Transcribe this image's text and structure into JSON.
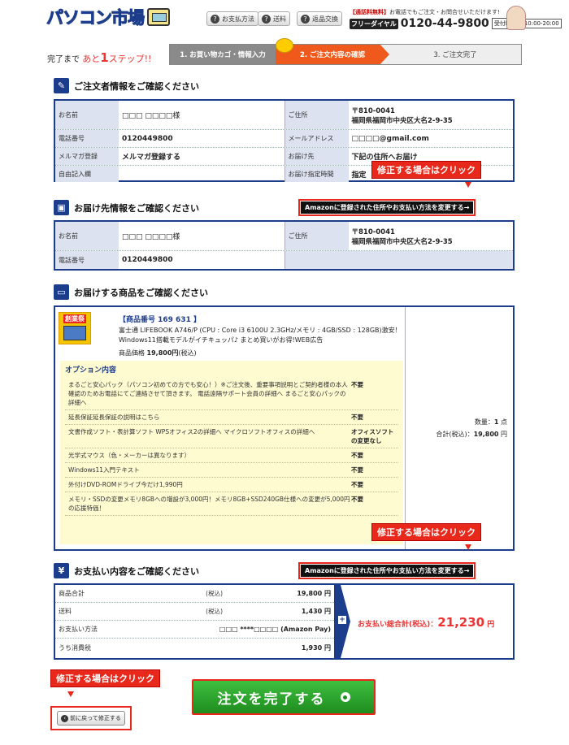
{
  "header": {
    "logo_text": "パソコン市場",
    "buttons": [
      "お支払方法",
      "送料",
      "返品交換"
    ],
    "tel_note_prefix": "【通話料無料】",
    "tel_note": "お電話でもご注文・お問合せいただけます!",
    "tel_badge": "フリーダイヤル",
    "tel_number": "0120-44-9800",
    "tel_hours_label": "受付時間",
    "tel_hours": "10:00-20:00"
  },
  "steps": {
    "left_prefix": "完了まで",
    "left_ato": "あと",
    "left_num": "1",
    "left_suffix": "ステップ!!",
    "items": [
      "1. お買い物カゴ・情報入力",
      "2. ご注文内容の確認",
      "3. ご注文完了"
    ]
  },
  "orderer": {
    "title": "ご注文者情報をご確認ください",
    "name_label": "お名前",
    "name": "□□□ □□□□様",
    "address_label": "ご住所",
    "postal": "〒810-0041",
    "address": "福岡県福岡市中央区大名2-9-35",
    "phone_label": "電話番号",
    "phone": "0120449800",
    "email_label": "メールアドレス",
    "email": "□□□□@gmail.com",
    "mailmag_label": "メルマガ登録",
    "mailmag": "メルマガ登録する",
    "deliver_label": "お届け先",
    "deliver": "下記の住所へお届け",
    "free_label": "自由記入欄",
    "free": "",
    "time_label": "お届け指定時間",
    "time": "指定"
  },
  "edit_label": "修正する場合はクリック",
  "amazon_change": "Amazonに登録された住所やお支払い方法を変更する→",
  "shipping": {
    "title": "お届け先情報をご確認ください",
    "name_label": "お名前",
    "name": "□□□ □□□□様",
    "address_label": "ご住所",
    "postal": "〒810-0041",
    "address": "福岡県福岡市中央区大名2-9-35",
    "phone_label": "電話番号",
    "phone": "0120449800"
  },
  "products": {
    "title": "お届けする商品をご確認ください",
    "badge": "創業祭",
    "item_no": "【商品番号 169 631 】",
    "desc": "富士通 LIFEBOOK A746/P (CPU : Core i3 6100U 2.3GHz/メモリ : 4GB/SSD : 128GB)激安！Windows11搭載モデルがイチキュッパ♪ まとめ買いがお得!WEB広告",
    "price_label": "商品価格",
    "price": "19,800円",
    "price_tax": "(税込)",
    "options_title": "オプション内容",
    "options": [
      {
        "q": "まるごと安心パック（パソコン初めての方でも安心！）※ご注文後、重要事項説明とご契約者様の本人確認のためお電話にてご連絡させて頂きます。 電話遠隔サポート会員の詳細へ まるごと安心パックの詳細へ",
        "a": "不要"
      },
      {
        "q": "延長保証延長保証の説明はこちら",
        "a": "不要"
      },
      {
        "q": "文書作成ソフト・表計算ソフト WPSオフィス2の詳細へ マイクロソフトオフィスの詳細へ",
        "a": "オフィスソフトの変更なし"
      },
      {
        "q": "光学式マウス（色・メーカーは異なります）",
        "a": "不要"
      },
      {
        "q": "Windows11入門テキスト",
        "a": "不要"
      },
      {
        "q": "外付けDVD-ROMドライブ今だけ1,990円",
        "a": "不要"
      },
      {
        "q": "メモリ・SSDの変更メモリ8GBへの増設が3,000円！メモリ8GB+SSD240GB仕様への変更が5,000円の応援特価！",
        "a": "不要"
      }
    ],
    "qty_label": "数量：",
    "qty": "1",
    "qty_unit": "点",
    "total_label": "合計(税込)：",
    "total": "19,800",
    "total_unit": "円"
  },
  "payment": {
    "title": "お支払い内容をご確認ください",
    "rows": [
      {
        "label": "商品合計",
        "tax": "(税込)",
        "value": "19,800 円"
      },
      {
        "label": "送料",
        "tax": "(税込)",
        "value": "1,430 円"
      },
      {
        "label": "お支払い方法",
        "tax": "",
        "value": "□□□ ****□□□□ (Amazon Pay)"
      },
      {
        "label": "うち消費税",
        "tax": "",
        "value": "1,930 円"
      }
    ],
    "grand_label": "お支払い総合計(税込)：",
    "grand_value": "21,230",
    "grand_unit": "円"
  },
  "footer": {
    "back_label": "前に戻って修正する",
    "complete_label": "注文を完了する"
  }
}
